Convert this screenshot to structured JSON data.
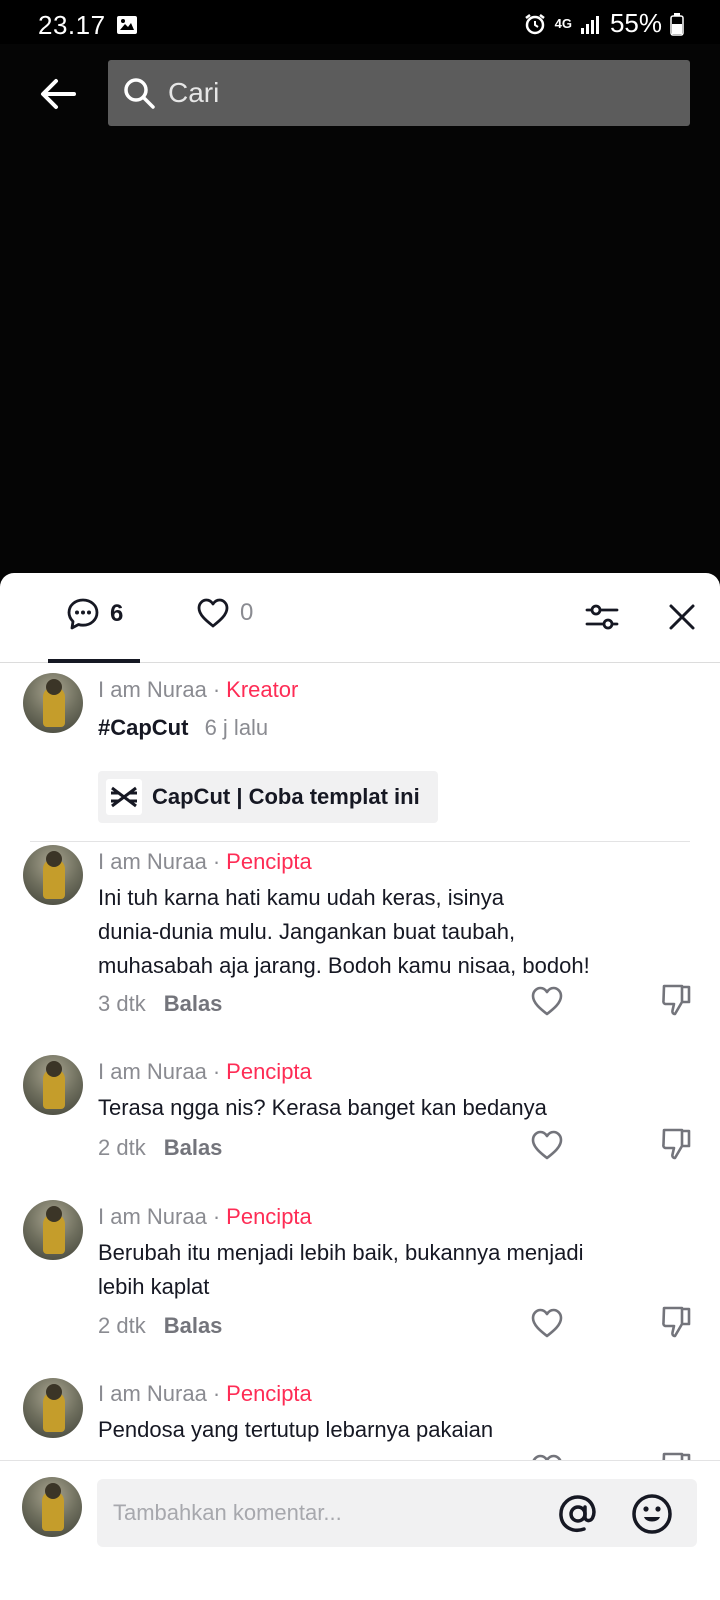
{
  "status_bar": {
    "time": "23.17",
    "network": "4G",
    "battery": "55%"
  },
  "search": {
    "placeholder": "Cari"
  },
  "tabs": {
    "comments_count": "6",
    "likes_count": "0"
  },
  "pinned": {
    "user": "I am Nuraa",
    "role": "Kreator",
    "hashtag": "#CapCut",
    "time": "6 j lalu",
    "chip_label": "CapCut | Coba templat ini"
  },
  "comments": [
    {
      "user": "I am Nuraa",
      "role": "Pencipta",
      "lines": [
        "Ini tuh karna hati kamu udah keras, isinya",
        "dunia-dunia mulu. Jangankan buat taubah,",
        "muhasabah aja jarang. Bodoh kamu nisaa, bodoh!"
      ],
      "time": "3 dtk",
      "reply": "Balas"
    },
    {
      "user": "I am Nuraa",
      "role": "Pencipta",
      "lines": [
        "Terasa ngga nis? Kerasa banget kan bedanya"
      ],
      "time": "2 dtk",
      "reply": "Balas"
    },
    {
      "user": "I am Nuraa",
      "role": "Pencipta",
      "lines": [
        "Berubah itu menjadi lebih baik, bukannya menjadi",
        "lebih kaplat"
      ],
      "time": "2 dtk",
      "reply": "Balas"
    },
    {
      "user": "I am Nuraa",
      "role": "Pencipta",
      "lines": [
        "Pendosa yang tertutup lebarnya pakaian"
      ],
      "time": "",
      "reply": ""
    }
  ],
  "comment_input": {
    "placeholder": "Tambahkan komentar..."
  },
  "colors": {
    "accent": "#fe2c55",
    "text": "#161823",
    "muted": "#8a8b91"
  },
  "icons": [
    "image-icon",
    "alarm-icon",
    "signal-icon",
    "battery-icon",
    "back-arrow-icon",
    "search-icon",
    "comment-bubble-icon",
    "heart-icon",
    "filter-icon",
    "close-icon",
    "capcut-logo-icon",
    "like-icon",
    "dislike-icon",
    "at-icon",
    "emoji-icon"
  ]
}
